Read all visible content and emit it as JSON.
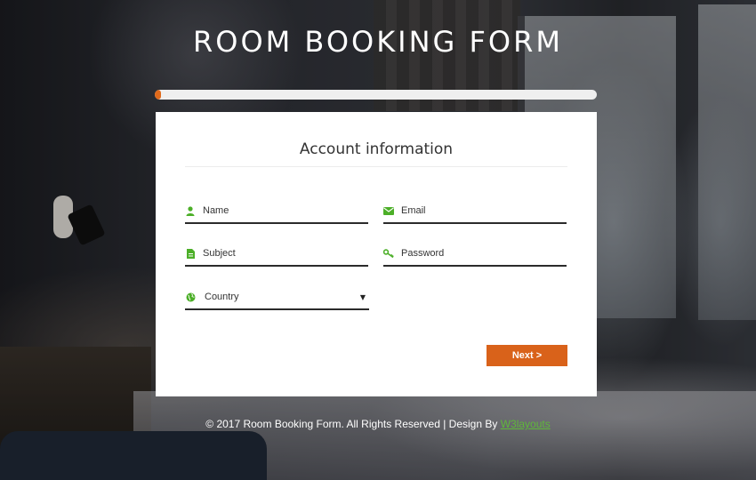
{
  "page": {
    "title": "ROOM BOOKING FORM"
  },
  "progress": {
    "value_percent": 1,
    "fill_color": "#e06a1b",
    "track_color": "#efefef"
  },
  "form": {
    "heading": "Account information",
    "fields": {
      "name": {
        "label": "Name",
        "icon": "user-icon"
      },
      "email": {
        "label": "Email",
        "icon": "envelope-icon"
      },
      "subject": {
        "label": "Subject",
        "icon": "document-icon"
      },
      "password": {
        "label": "Password",
        "icon": "key-icon"
      },
      "country": {
        "label": "Country",
        "icon": "globe-icon",
        "selected": "Country"
      }
    },
    "next_label": "Next >",
    "icon_color": "#4caf28",
    "button_color": "#d9621a"
  },
  "footer": {
    "text": "© 2017 Room Booking Form. All Rights Reserved | Design By ",
    "link_text": "W3layouts",
    "link_color": "#5fb83a"
  }
}
